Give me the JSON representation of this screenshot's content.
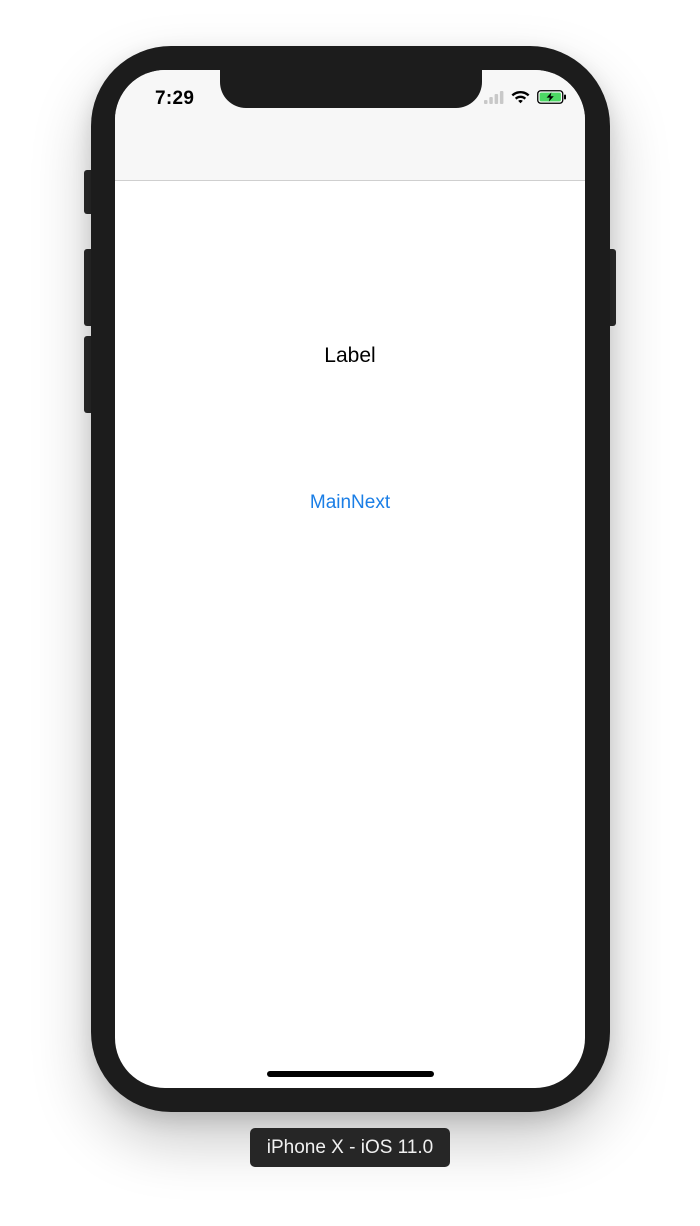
{
  "status_bar": {
    "time": "7:29",
    "icons": [
      "cellular-signal-icon",
      "wifi-icon",
      "battery-charging-icon"
    ]
  },
  "content": {
    "label_text": "Label",
    "button_text": "MainNext"
  },
  "simulator": {
    "device_caption": "iPhone X - iOS 11.0"
  },
  "colors": {
    "device_frame": "#1c1c1c",
    "nav_background": "#f7f7f7",
    "button_tint": "#1a7ee6",
    "battery_green": "#4cd964"
  }
}
